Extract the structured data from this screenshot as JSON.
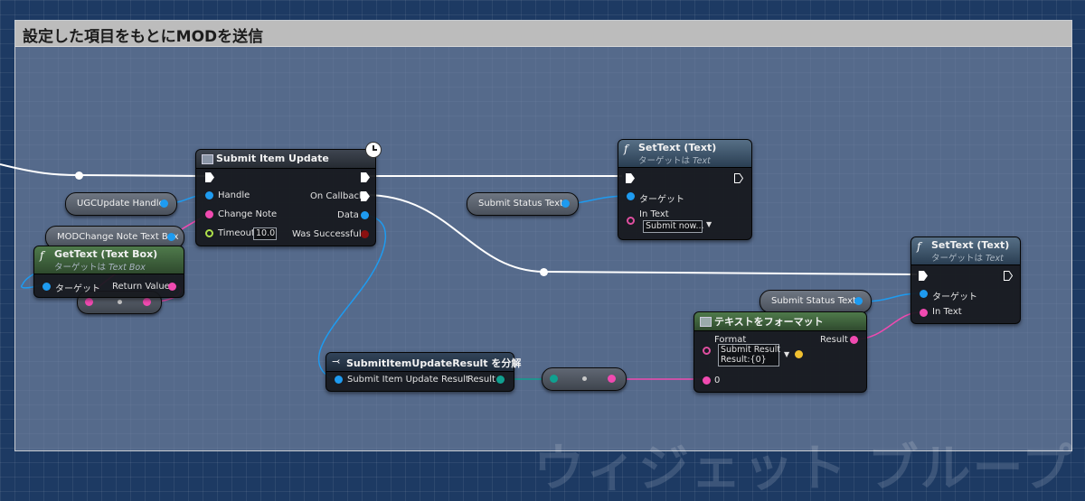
{
  "comment": {
    "title": "設定した項目をもとにMODを送信"
  },
  "watermark": "ウィジェット ブループリント",
  "nodes": {
    "submit_item_update": {
      "title": "Submit Item Update",
      "handle": "Handle",
      "change_note": "Change Note",
      "timeout": "Timeout",
      "timeout_value": "10.0",
      "on_callback": "On Callback",
      "data": "Data",
      "was_successful": "Was Successful"
    },
    "settext_1": {
      "title": "SetText (Text)",
      "subtitle_prefix": "ターゲットは",
      "subtitle_target": "Text",
      "target": "ターゲット",
      "in_text": "In Text",
      "in_text_value": "Submit now..."
    },
    "settext_2": {
      "title": "SetText (Text)",
      "subtitle_prefix": "ターゲットは",
      "subtitle_target": "Text",
      "target": "ターゲット",
      "in_text": "In Text"
    },
    "gettext": {
      "title": "GetText (Text Box)",
      "subtitle_prefix": "ターゲットは",
      "subtitle_target": "Text Box",
      "target": "ターゲット",
      "return_value": "Return Value"
    },
    "split_result": {
      "title": "SubmitItemUpdateResult を分解",
      "input": "Submit Item Update Result",
      "output": "Result"
    },
    "format_text": {
      "title": "テキストをフォーマット",
      "format": "Format",
      "format_value_line1": "Submit Result",
      "format_value_line2": "Result:{0}",
      "result": "Result",
      "arg0": "0"
    }
  },
  "variables": {
    "ugc_handle": "UGCUpdate Handle",
    "mod_change_note": "MODChange Note Text Box",
    "status_text_1": "Submit Status Text",
    "status_text_2": "Submit Status Text"
  },
  "colors": {
    "exec_wire": "#ffffff",
    "object_pin": "#1e9bf0",
    "text_pin": "#f04ab0",
    "struct_pin": "#10a090",
    "float_pin": "#aee04a"
  }
}
